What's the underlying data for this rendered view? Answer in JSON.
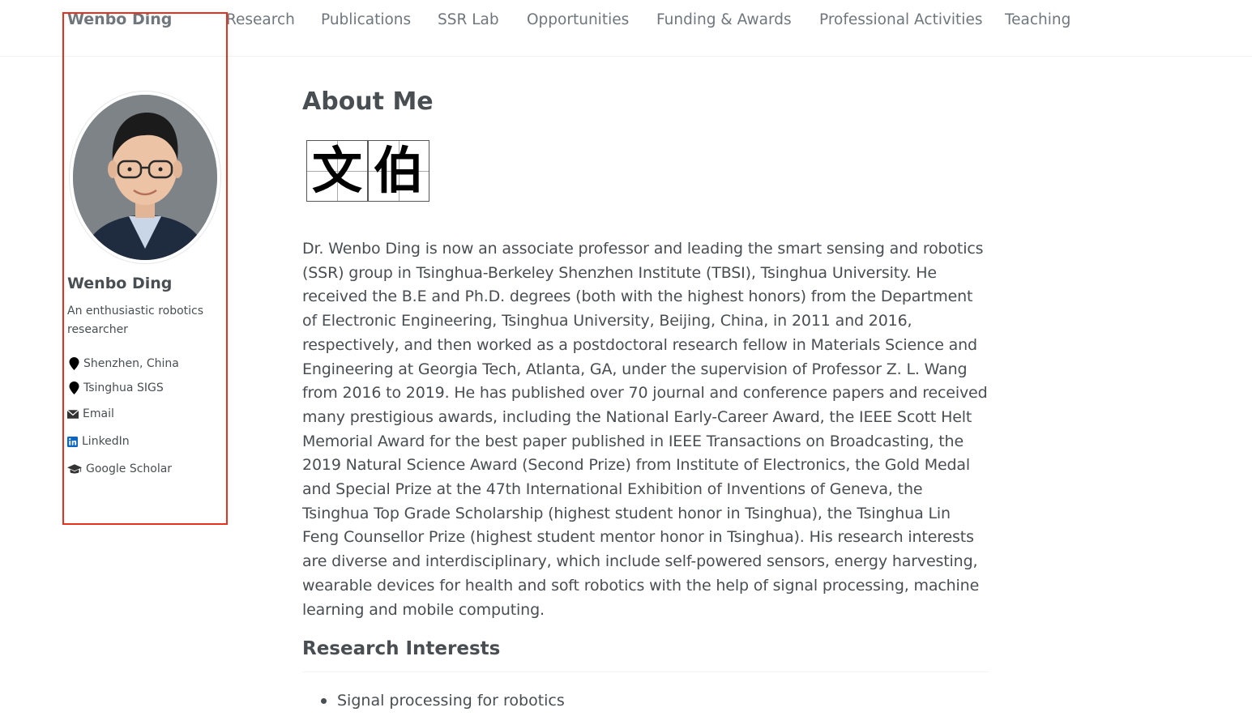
{
  "masthead": {
    "site_title": "Wenbo Ding",
    "nav": [
      {
        "label": "Research"
      },
      {
        "label": "Publications"
      },
      {
        "label": "SSR Lab"
      },
      {
        "label": "Opportunities"
      },
      {
        "label": "Funding & Awards"
      },
      {
        "label": "Professional Activities"
      },
      {
        "label": "Teaching"
      }
    ]
  },
  "sidebar": {
    "author_name": "Wenbo Ding",
    "bio": "An enthusiastic robotics researcher",
    "links": [
      {
        "label": "Shenzhen, China",
        "icon": "location-pin-icon"
      },
      {
        "label": "Tsinghua SIGS",
        "icon": "location-pin-icon"
      },
      {
        "label": "Email",
        "icon": "envelope-icon"
      },
      {
        "label": "LinkedIn",
        "icon": "linkedin-icon"
      },
      {
        "label": "Google Scholar",
        "icon": "graduation-cap-icon"
      }
    ]
  },
  "main": {
    "title": "About Me",
    "calligraphy": [
      "文",
      "伯"
    ],
    "bio_paragraph": "Dr. Wenbo Ding is now an associate professor and leading the smart sensing and robotics (SSR) group in Tsinghua-Berkeley Shenzhen Institute (TBSI), Tsinghua University. He received the B.E and Ph.D. degrees (both with the highest honors) from the Department of Electronic Engineering, Tsinghua University, Beijing, China, in 2011 and 2016, respectively, and then worked as a postdoctoral research fellow in Materials Science and Engineering at Georgia Tech, Atlanta, GA, under the supervision of Professor Z. L. Wang from 2016 to 2019. He has published over 70 journal and conference papers and received many prestigious awards, including the National Early-Career Award, the IEEE Scott Helt Memorial Award for the best paper published in IEEE Transactions on Broadcasting, the 2019 Natural Science Award (Second Prize) from Institute of Electronics, the Gold Medal and Special Prize at the 47th International Exhibition of Inventions of Geneva, the Tsinghua Top Grade Scholarship (highest student honor in Tsinghua), the Tsinghua Lin Feng Counsellor Prize (highest student mentor honor in Tsinghua). His research interests are diverse and interdisciplinary, which include self-powered sensors, energy harvesting, wearable devices for health and soft robotics with the help of signal processing, machine learning and mobile computing.",
    "research_interests_title": "Research Interests",
    "research_interests": [
      "Signal processing for robotics"
    ]
  },
  "colors": {
    "text": "#494e52",
    "nav_text": "#6f777d",
    "highlight": "#e8301c",
    "linkedin": "#0a66c2"
  }
}
